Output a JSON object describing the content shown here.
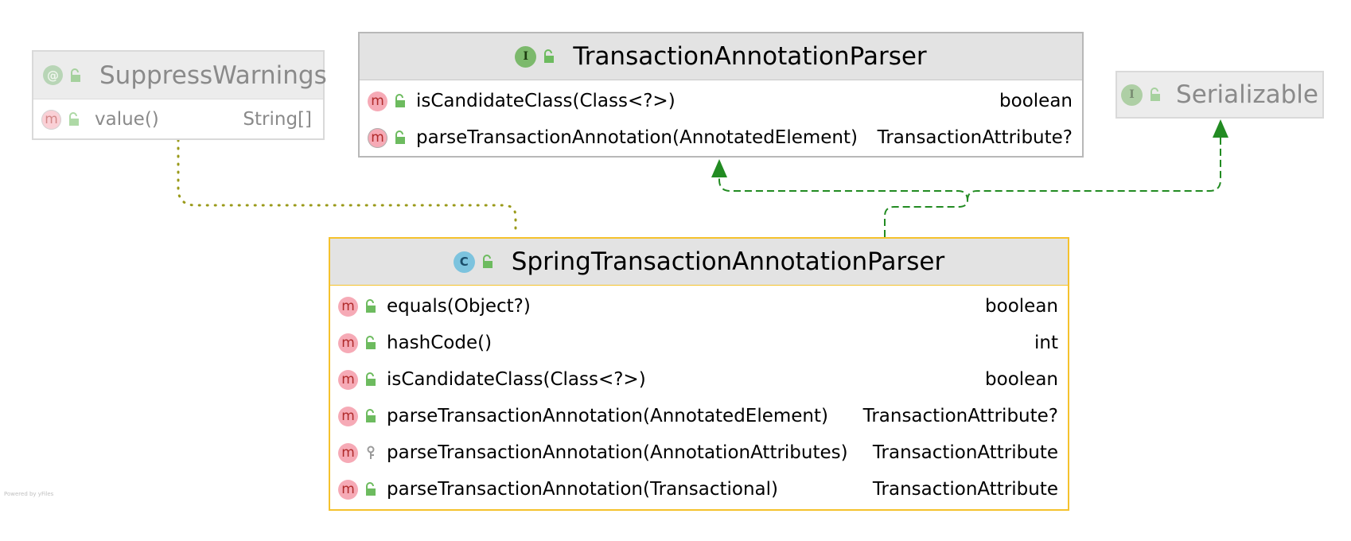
{
  "colors": {
    "inheritance_edge": "#228B22",
    "annotation_edge": "#9a9a1a",
    "selected_border": "#f5c22d",
    "node_border": "#b8b8b8",
    "header_bg": "#e3e3e3",
    "method_badge": "#f6aab6",
    "interface_badge": "#7cb96c",
    "class_badge": "#7cc3de"
  },
  "nodes": {
    "suppress_warnings": {
      "kind_badge": "@",
      "title": "SuppressWarnings",
      "icon": "annotation-icon",
      "members": [
        {
          "badge": "m",
          "signature": "value()",
          "return_type": "String[]",
          "visibility": "public"
        }
      ]
    },
    "transaction_annotation_parser": {
      "kind_badge": "I",
      "title": "TransactionAnnotationParser",
      "icon": "interface-icon",
      "members": [
        {
          "badge": "m",
          "signature": "isCandidateClass(Class<?>)",
          "return_type": "boolean",
          "visibility": "public"
        },
        {
          "badge": "m",
          "signature": "parseTransactionAnnotation(AnnotatedElement)",
          "return_type": "TransactionAttribute?",
          "visibility": "public"
        }
      ]
    },
    "serializable": {
      "kind_badge": "I",
      "title": "Serializable",
      "icon": "interface-icon",
      "members": []
    },
    "spring_transaction_annotation_parser": {
      "kind_badge": "C",
      "title": "SpringTransactionAnnotationParser",
      "icon": "class-icon",
      "members": [
        {
          "badge": "m",
          "signature": "equals(Object?)",
          "return_type": "boolean",
          "visibility": "public"
        },
        {
          "badge": "m",
          "signature": "hashCode()",
          "return_type": "int",
          "visibility": "public"
        },
        {
          "badge": "m",
          "signature": "isCandidateClass(Class<?>)",
          "return_type": "boolean",
          "visibility": "public"
        },
        {
          "badge": "m",
          "signature": "parseTransactionAnnotation(AnnotatedElement)",
          "return_type": "TransactionAttribute?",
          "visibility": "public"
        },
        {
          "badge": "m",
          "signature": "parseTransactionAnnotation(AnnotationAttributes)",
          "return_type": "TransactionAttribute",
          "visibility": "protected"
        },
        {
          "badge": "m",
          "signature": "parseTransactionAnnotation(Transactional)",
          "return_type": "TransactionAttribute",
          "visibility": "public"
        }
      ]
    }
  },
  "edges": [
    {
      "from": "spring_transaction_annotation_parser",
      "to": "transaction_annotation_parser",
      "kind": "implements"
    },
    {
      "from": "spring_transaction_annotation_parser",
      "to": "serializable",
      "kind": "implements"
    },
    {
      "from": "spring_transaction_annotation_parser",
      "to": "suppress_warnings",
      "kind": "annotated-by"
    }
  ],
  "footer": "Powered by yFiles"
}
